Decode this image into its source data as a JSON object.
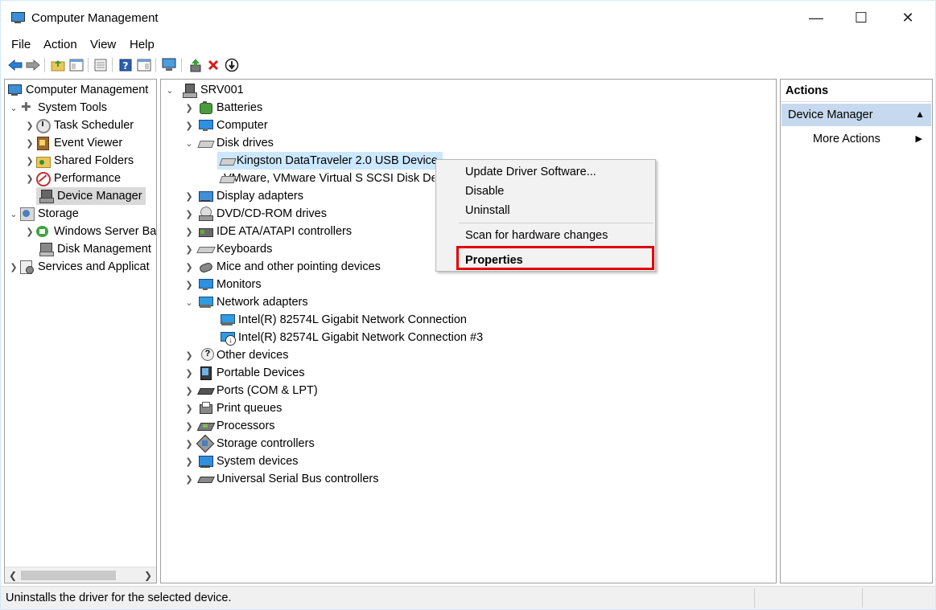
{
  "window": {
    "title": "Computer Management",
    "minimize": "—",
    "maximize": "☐",
    "close": "✕"
  },
  "menu": [
    "File",
    "Action",
    "View",
    "Help"
  ],
  "toolbar_icons": [
    "back-arrow-icon",
    "forward-arrow-icon",
    "up-folder-icon",
    "show-hide-tree-icon",
    "export-list-icon",
    "help-icon",
    "properties-icon",
    "scan-hardware-icon",
    "update-driver-icon",
    "uninstall-icon",
    "disable-icon"
  ],
  "left_tree": {
    "root": "Computer Management",
    "system_tools": "System Tools",
    "task_scheduler": "Task Scheduler",
    "event_viewer": "Event Viewer",
    "shared_folders": "Shared Folders",
    "performance": "Performance",
    "device_manager": "Device Manager",
    "storage": "Storage",
    "windows_server_backup": "Windows Server Ba",
    "disk_management": "Disk Management",
    "services": "Services and Applicat"
  },
  "device_tree": {
    "root": "SRV001",
    "batteries": "Batteries",
    "computer": "Computer",
    "disk_drives": "Disk drives",
    "disk_kingston": "Kingston DataTraveler 2.0 USB Device",
    "disk_vmware": "VMware, VMware Virtual S SCSI Disk Device",
    "display_adapters": "Display adapters",
    "dvd": "DVD/CD-ROM drives",
    "ide": "IDE ATA/ATAPI controllers",
    "keyboards": "Keyboards",
    "mice": "Mice and other pointing devices",
    "monitors": "Monitors",
    "network_adapters": "Network adapters",
    "nic1": "Intel(R) 82574L Gigabit Network Connection",
    "nic2": "Intel(R) 82574L Gigabit Network Connection #3",
    "other_devices": "Other devices",
    "portable_devices": "Portable Devices",
    "ports": "Ports (COM & LPT)",
    "print_queues": "Print queues",
    "processors": "Processors",
    "storage_controllers": "Storage controllers",
    "system_devices": "System devices",
    "usb_controllers": "Universal Serial Bus controllers"
  },
  "context_menu": {
    "update_driver": "Update Driver Software...",
    "disable": "Disable",
    "uninstall": "Uninstall",
    "scan": "Scan for hardware changes",
    "properties": "Properties"
  },
  "actions": {
    "header": "Actions",
    "section": "Device Manager",
    "more": "More Actions"
  },
  "status": {
    "text": "Uninstalls the driver for the selected device."
  },
  "colors": {
    "selection_gray": "#d9d9d9",
    "selection_blue": "#cce8ff",
    "actions_section": "#c6d9ee",
    "highlight_red": "#e00000"
  }
}
